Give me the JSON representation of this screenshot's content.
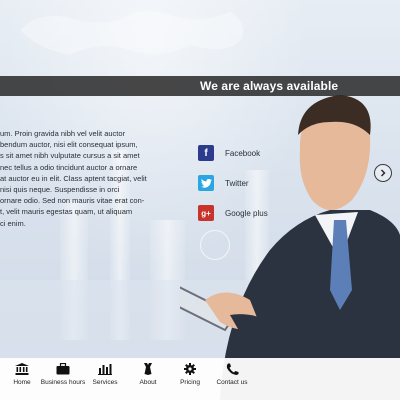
{
  "banner": {
    "title": "We are always available"
  },
  "body_text": "um. Proin gravida nibh vel velit auctor\nbendum auctor, nisi elit consequat ipsum,\ns sit amet nibh vulputate cursus a sit amet\nnec tellus a odio tincidunt auctor a ornare\nat auctor eu in elit. Class aptent tacgiat, velit\nnisi quis neque. Suspendisse in orci\nornare odio. Sed non  mauris vitae erat con-\nt, velit mauris egestas quam, ut aliquam\nci enim.",
  "social": [
    {
      "label": "Facebook",
      "icon": "facebook-icon",
      "color": "#2d3b8c",
      "glyph": "f"
    },
    {
      "label": "Twitter",
      "icon": "twitter-icon",
      "color": "#2aa7e0",
      "glyph": "t"
    },
    {
      "label": "Google plus",
      "icon": "google-plus-icon",
      "color": "#c8332b",
      "glyph": "g+"
    }
  ],
  "nav": {
    "items": [
      {
        "label": "Home",
        "icon": "bank-icon"
      },
      {
        "label": "Business hours",
        "icon": "briefcase-icon"
      },
      {
        "label": "Services",
        "icon": "bar-chart-icon"
      },
      {
        "label": "About",
        "icon": "person-tie-icon"
      },
      {
        "label": "Pricing",
        "icon": "gear-icon"
      },
      {
        "label": "Contact us",
        "icon": "phone-icon"
      }
    ]
  },
  "colors": {
    "banner_bg": "#282828",
    "text": "#2b2f36",
    "nav_bg": "#ffffff"
  }
}
